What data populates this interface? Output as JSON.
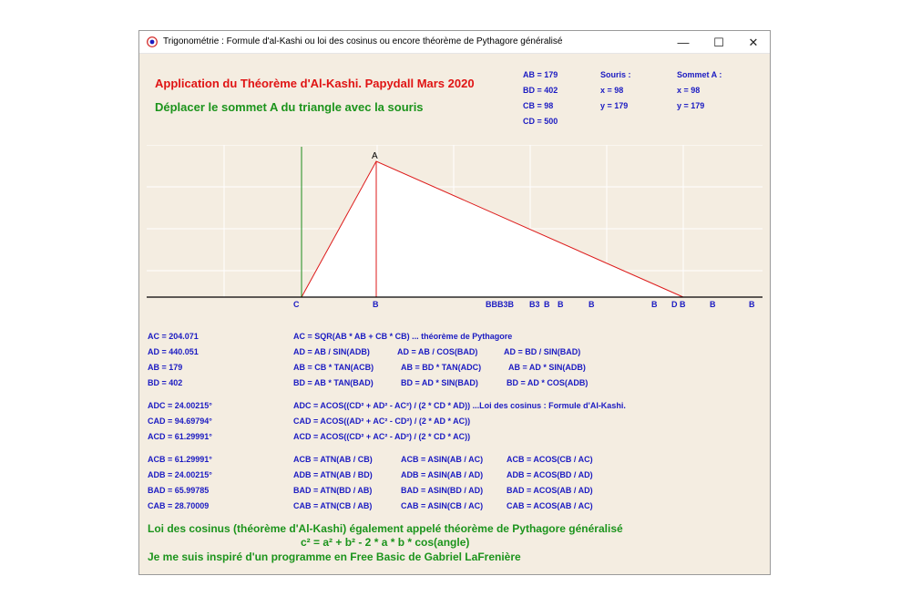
{
  "window": {
    "title": "Trigonométrie : Formule d'al-Kashi ou loi des cosinus ou encore théorème de Pythagore généralisé",
    "buttons": {
      "minimize": "—",
      "maximize": "☐",
      "close": "✕"
    }
  },
  "header": {
    "title": "Application du Théorème d'Al-Kashi. Papydall Mars 2020",
    "instruction": "Déplacer le sommet  A du triangle avec la souris"
  },
  "info": {
    "lengths": [
      "AB = 179",
      "BD = 402",
      "CB = 98",
      "CD = 500"
    ],
    "mouse": {
      "label": "Souris :",
      "x": "x = 98",
      "y": "y = 179"
    },
    "vertex": {
      "label": "Sommet A :",
      "x": "x = 98",
      "y": "y = 179"
    }
  },
  "plot": {
    "vertex_a": "A",
    "baseline_labels": [
      "C",
      "B",
      "BBB3B",
      "B3",
      "B",
      "B",
      "B",
      "B",
      "D B",
      "B",
      "B"
    ],
    "colors": {
      "triangle_fill": "#ffffff",
      "triangle_edge": "#dd1a1a",
      "axis": "#000000",
      "vertical": "#1a8a1a"
    }
  },
  "results": [
    [
      "AC = 204.071",
      "AD = 440.051",
      "AB = 179",
      "BD = 402"
    ],
    [
      "ADC = 24.00215°",
      "CAD = 94.69794°",
      "ACD = 61.29991°"
    ],
    [
      "ACB = 61.29991°",
      "ADB = 24.00215°",
      "BAD = 65.99785",
      "CAB = 28.70009"
    ]
  ],
  "formulas": {
    "row1": "AC = SQR(AB * AB + CB * CB) ... théorème de Pythagore",
    "row2": [
      "AD = AB / SIN(ADB)",
      "AD = AB / COS(BAD)",
      "AD = BD / SIN(BAD)"
    ],
    "row3": [
      "AB = CB * TAN(ACB)",
      "AB = BD * TAN(ADC)",
      "AB = AD * SIN(ADB)"
    ],
    "row4": [
      "BD = AB * TAN(BAD)",
      "BD = AD * SIN(BAD)",
      "BD = AD * COS(ADB)"
    ],
    "cos1": "ADC = ACOS((CD² + AD² - AC²) / (2 * CD * AD)) ...Loi des cosinus : Formule d'Al-Kashi.",
    "cos2": "CAD = ACOS((AD² + AC² - CD²) / (2 * AD * AC))",
    "cos3": "ACD = ACOS((CD² + AC² - AD²) / (2 * CD * AC))",
    "trig": [
      [
        "ACB = ATN(AB / CB)",
        "ACB = ASIN(AB / AC)",
        "ACB = ACOS(CB / AC)"
      ],
      [
        "ADB = ATN(AB / BD)",
        "ADB = ASIN(AB / AD)",
        "ADB = ACOS(BD / AD)"
      ],
      [
        "BAD = ATN(BD / AB)",
        "BAD = ASIN(BD / AD)",
        "BAD = ACOS(AB / AD)"
      ],
      [
        "CAB = ATN(CB / AB)",
        "CAB = ASIN(CB / AC)",
        "CAB = ACOS(AB / AC)"
      ]
    ]
  },
  "footer": {
    "line1": "Loi des cosinus (théorème d'Al-Kashi) également appelé théorème de Pythagore généralisé",
    "line2": "c² = a² + b² - 2 * a * b * cos(angle)",
    "line3": "Je me suis inspiré d'un programme en Free Basic de Gabriel LaFrenière"
  }
}
